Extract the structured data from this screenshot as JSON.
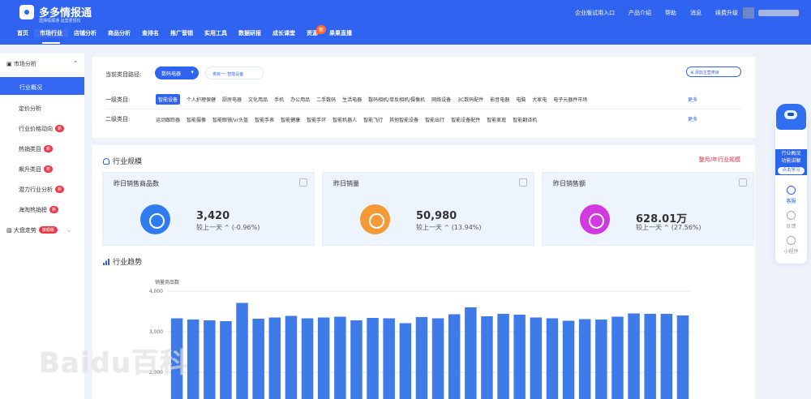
{
  "header": {
    "brand": "多多情报通",
    "slogan": "选择情报通 运营更轻松",
    "nav": [
      "首页",
      "市场行业",
      "店铺分析",
      "商品分析",
      "查排名",
      "推广营销",
      "实用工具",
      "数据研报",
      "成长课堂",
      "资源",
      "果果直播"
    ],
    "new_tag": "新",
    "right_links": [
      "企业版试用入口",
      "产品介绍",
      "帮助",
      "消息",
      "续费升级"
    ]
  },
  "sidebar": {
    "section": "市场分析",
    "items": [
      {
        "label": "行业概况",
        "active": true
      },
      {
        "label": "定价分析"
      },
      {
        "label": "行业价格动向",
        "tag": "新"
      },
      {
        "label": "热销类目",
        "tag": "新"
      },
      {
        "label": "飙升类目",
        "tag": "新"
      },
      {
        "label": "潜力行业分析",
        "tag": "新"
      },
      {
        "label": "海淘热销榜",
        "tag": "新"
      }
    ],
    "big_trend": "大盘走势",
    "flagship": "旗舰版"
  },
  "filter": {
    "path_label": "当前类目路径:",
    "selected_path": "数码电器",
    "sub_path": "类目一: 智能设备",
    "add_main": "添加主营类目",
    "first_label": "一级类目:",
    "first_categories": [
      "智能设备",
      "个人护理保健",
      "厨房电器",
      "文化用品",
      "手机",
      "办公用品",
      "二手数码",
      "生活电器",
      "数码相机/单反相机/摄像机",
      "网络设备",
      "3C数码配件",
      "影音电器",
      "电脑",
      "大家电",
      "电子元器件市场"
    ],
    "second_label": "二级类目:",
    "second_categories": [
      "运动跟踪器",
      "智能摄像",
      "智能眼镜/vr头盔",
      "智能手表",
      "智能健康",
      "智能手环",
      "智能机器人",
      "智能飞行",
      "其他智能设备",
      "智能出行",
      "智能设备配件",
      "智能家庭",
      "智能翻译机"
    ],
    "more": "更多"
  },
  "industry": {
    "title": "行业规模",
    "month_link": "整月/年行业规模",
    "cards": [
      {
        "title": "昨日销售商品数",
        "value": "3,420",
        "delta": "较上一天 ^ (-0.96%)",
        "color": "#2f7cf2"
      },
      {
        "title": "昨日销量",
        "value": "50,980",
        "delta": "较上一天 ^ (13.94%)",
        "color": "#f39a37"
      },
      {
        "title": "昨日销售额",
        "value": "628.01万",
        "delta": "较上一天 ^ (27.56%)",
        "color": "#d13ae0"
      }
    ]
  },
  "trend": {
    "title": "行业趋势"
  },
  "chart_data": {
    "type": "bar",
    "title": "",
    "ylabel": "销量商品数",
    "ylim": [
      2000,
      4000
    ],
    "yticks": [
      "4,000",
      "3,000",
      "2,000"
    ],
    "values": [
      3330,
      3300,
      3280,
      3260,
      3710,
      3320,
      3350,
      3390,
      3330,
      3350,
      3370,
      3280,
      3340,
      3330,
      3210,
      3360,
      3330,
      3430,
      3600,
      3380,
      3440,
      3420,
      3350,
      3330,
      3270,
      3310,
      3300,
      3370,
      3450,
      3440,
      3440,
      3400
    ]
  },
  "right_panel": {
    "feature_line1": "行业概况",
    "feature_line2": "功能讲解",
    "learn": "点击学习",
    "service": "客服",
    "feedback": "反馈",
    "mini": "小程序"
  },
  "watermark": "Baidu百科"
}
